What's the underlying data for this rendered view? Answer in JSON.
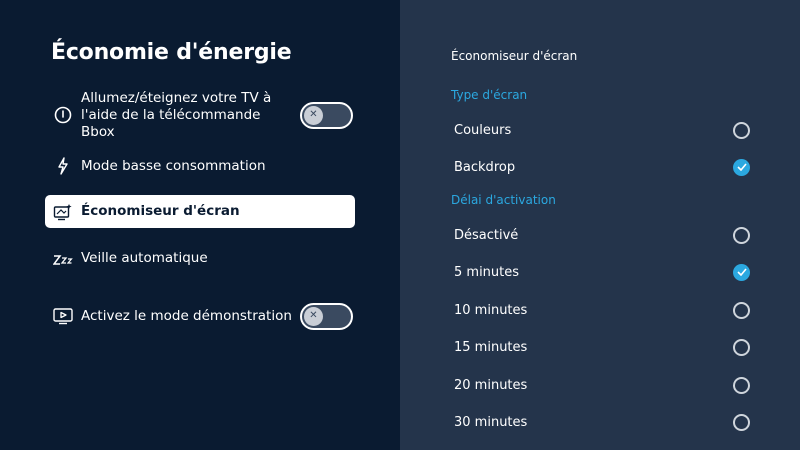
{
  "page_title": "Économie d'énergie",
  "menu": [
    {
      "label": "Allumez/éteignez votre TV à l'aide de la télécommande Bbox",
      "icon": "power-info-icon",
      "toggle": false
    },
    {
      "label": "Mode basse consommation",
      "icon": "lightning-icon"
    },
    {
      "label": "Économiseur d'écran",
      "icon": "screen-saver-icon",
      "selected": true
    },
    {
      "label": "Veille automatique",
      "icon": "sleep-zzz-icon"
    },
    {
      "label": "Activez le mode démonstration",
      "icon": "demo-screen-icon",
      "toggle": false
    }
  ],
  "toggle_off_glyph": "✕",
  "panel": {
    "title": "Économiseur d'écran",
    "sections": [
      {
        "label": "Type d'écran",
        "options": [
          {
            "label": "Couleurs",
            "checked": false
          },
          {
            "label": "Backdrop",
            "checked": true
          }
        ]
      },
      {
        "label": "Délai d'activation",
        "options": [
          {
            "label": "Désactivé",
            "checked": false
          },
          {
            "label": "5 minutes",
            "checked": true
          },
          {
            "label": "10 minutes",
            "checked": false
          },
          {
            "label": "15 minutes",
            "checked": false
          },
          {
            "label": "20 minutes",
            "checked": false
          },
          {
            "label": "30 minutes",
            "checked": false
          }
        ]
      }
    ]
  },
  "colors": {
    "left_bg": "#0a1b31",
    "right_bg": "#24344b",
    "accent": "#2ba8e0",
    "text": "#ffffff"
  }
}
